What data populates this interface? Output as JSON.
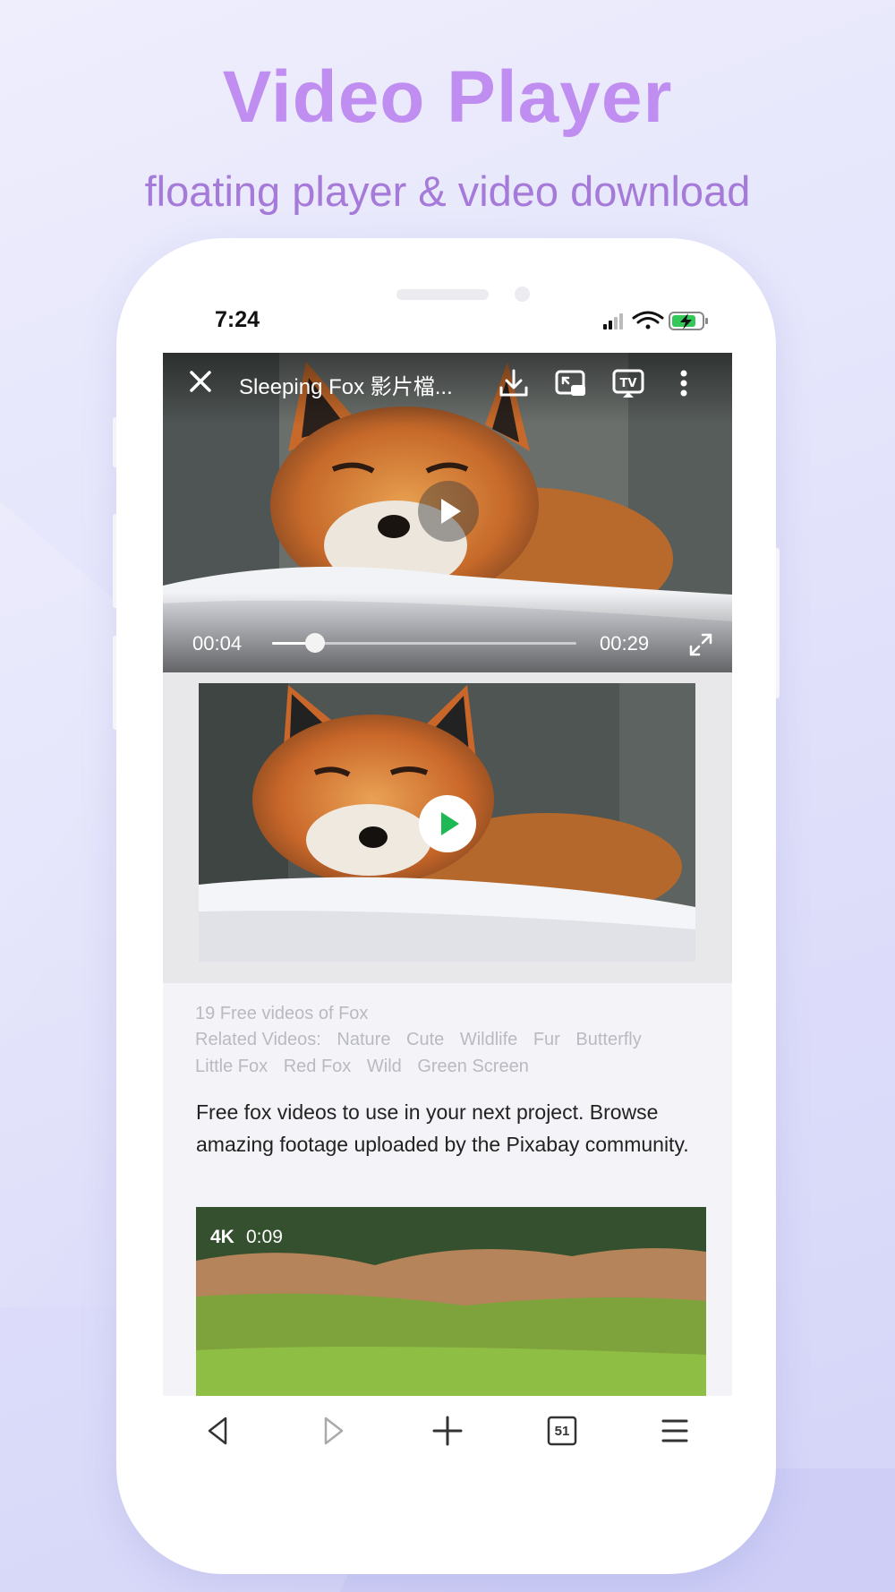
{
  "promo": {
    "title": "Video Player",
    "subtitle": "floating player & video download"
  },
  "status_bar": {
    "time": "7:24",
    "icons": [
      "signal-icon",
      "wifi-icon",
      "battery-charging-icon"
    ]
  },
  "player": {
    "title": "Sleeping Fox 影片檔...",
    "current_time": "00:04",
    "total_time": "00:29",
    "progress_fraction": 0.14,
    "icons": [
      "close-icon",
      "download-icon",
      "floating-window-icon",
      "tv-cast-icon",
      "more-vert-icon",
      "play-icon",
      "fullscreen-icon"
    ]
  },
  "page": {
    "count_line": "19 Free videos of Fox",
    "related_label": "Related Videos:",
    "related_tags": [
      "Nature",
      "Cute",
      "Wildlife",
      "Fur",
      "Butterfly",
      "Little Fox",
      "Red Fox",
      "Wild",
      "Green Screen"
    ],
    "description": "Free fox videos to use in your next project. Browse amazing footage uploaded by the Pixabay community.",
    "next_video": {
      "quality": "4K",
      "duration": "0:09"
    }
  },
  "bottom_nav": {
    "tab_count": "51",
    "icons": [
      "back-icon",
      "forward-icon",
      "new-tab-icon",
      "tabs-icon",
      "menu-icon"
    ]
  },
  "colors": {
    "title": "#c08ef0",
    "subtitle": "#a57ad8",
    "accent_green": "#1db954",
    "background": "#e2e2fb"
  }
}
